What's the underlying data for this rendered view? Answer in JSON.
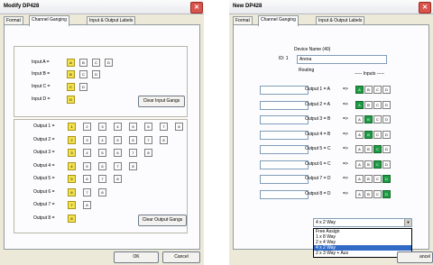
{
  "window1": {
    "title": "Modify DP428",
    "tabs": [
      "Format",
      "Channel Ganging",
      "Input & Output Labels"
    ],
    "inputs": [
      {
        "label": "Input A =",
        "boxes": [
          "A",
          "B",
          "C",
          "D"
        ],
        "highlight": [
          0
        ]
      },
      {
        "label": "Input B =",
        "boxes": [
          "B",
          "C",
          "D"
        ],
        "highlight": [
          0
        ]
      },
      {
        "label": "Input C =",
        "boxes": [
          "C",
          "D"
        ],
        "highlight": [
          0
        ]
      },
      {
        "label": "Input D =",
        "boxes": [
          "D"
        ],
        "highlight": [
          0
        ]
      }
    ],
    "clear_input_btn": "Clear Input Gangs",
    "outputs": [
      {
        "label": "Output 1 =",
        "boxes": [
          "1",
          "2",
          "3",
          "4",
          "5",
          "6",
          "7",
          "8"
        ],
        "highlight": [
          0
        ]
      },
      {
        "label": "Output 2 =",
        "boxes": [
          "2",
          "3",
          "4",
          "5",
          "6",
          "7",
          "8"
        ],
        "highlight": [
          0
        ]
      },
      {
        "label": "Output 3 =",
        "boxes": [
          "3",
          "4",
          "5",
          "6",
          "7",
          "8"
        ],
        "highlight": [
          0
        ]
      },
      {
        "label": "Output 4 =",
        "boxes": [
          "4",
          "5",
          "6",
          "7",
          "8"
        ],
        "highlight": [
          0
        ]
      },
      {
        "label": "Output 5 =",
        "boxes": [
          "5",
          "6",
          "7",
          "8"
        ],
        "highlight": [
          0
        ]
      },
      {
        "label": "Output 6 =",
        "boxes": [
          "6",
          "7",
          "8"
        ],
        "highlight": [
          0
        ]
      },
      {
        "label": "Output 7 =",
        "boxes": [
          "7",
          "8"
        ],
        "highlight": [
          0
        ]
      },
      {
        "label": "Output 8 =",
        "boxes": [
          "8"
        ],
        "highlight": [
          0
        ]
      }
    ],
    "clear_output_btn": "Clear Output Gangs",
    "ok_btn": "OK",
    "cancel_btn": "Cancel"
  },
  "window2": {
    "title": "New DP428",
    "tabs": [
      "Format",
      "Channel Ganging",
      "Input & Output Labels"
    ],
    "device_name_label": "Device Name (40)",
    "id_label": "ID: 1",
    "device_name_value": "Arena",
    "routing_label": "Routing",
    "inputs_header": "----- Inputs -----",
    "routes": [
      {
        "label": "Output 1 = A",
        "arrow": "=>",
        "boxes": [
          "A",
          "B",
          "C",
          "D"
        ],
        "green": 0
      },
      {
        "label": "Output 2 = A",
        "arrow": "=>",
        "boxes": [
          "A",
          "B",
          "C",
          "D"
        ],
        "green": 0
      },
      {
        "label": "Output 3 = B",
        "arrow": "=>",
        "boxes": [
          "A",
          "B",
          "C",
          "D"
        ],
        "green": 1
      },
      {
        "label": "Output 4 = B",
        "arrow": "=>",
        "boxes": [
          "A",
          "B",
          "C",
          "D"
        ],
        "green": 1
      },
      {
        "label": "Output 5 = C",
        "arrow": "=>",
        "boxes": [
          "A",
          "B",
          "C",
          "D"
        ],
        "green": 2
      },
      {
        "label": "Output 6 = C",
        "arrow": "=>",
        "boxes": [
          "A",
          "B",
          "C",
          "D"
        ],
        "green": 2
      },
      {
        "label": "Output 7 = D",
        "arrow": "=>",
        "boxes": [
          "A",
          "B",
          "C",
          "D"
        ],
        "green": 3
      },
      {
        "label": "Output 8 = D",
        "arrow": "=>",
        "boxes": [
          "A",
          "B",
          "C",
          "D"
        ],
        "green": 3
      }
    ],
    "combo_value": "4 x 2 Way",
    "dropdown_options": [
      "Free Assign",
      "1 x 8 Way",
      "2 x 4 Way",
      "4 x 2 Way",
      "2 x 3 Way + Aux"
    ],
    "dropdown_selected": 3,
    "cancel_btn_partial": "ancel"
  },
  "colors": {
    "gang_on": "#f2e24d",
    "route_on": "#1f9b45",
    "selection": "#316ac5"
  }
}
